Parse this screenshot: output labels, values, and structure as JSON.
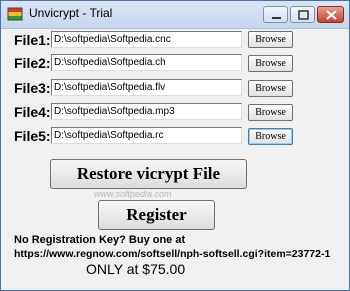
{
  "window": {
    "title": "Unvicrypt - Trial",
    "icon": "app-icon",
    "controls": [
      "minimize-icon",
      "maximize-icon",
      "close-icon"
    ]
  },
  "files": [
    {
      "label": "File1:",
      "value": "D:\\softpedia\\Softpedia.cnc",
      "browse_label": "Browse"
    },
    {
      "label": "File2:",
      "value": "D:\\softpedia\\Softpedia.ch",
      "browse_label": "Browse"
    },
    {
      "label": "File3:",
      "value": "D:\\softpedia\\Softpedia.flv",
      "browse_label": "Browse"
    },
    {
      "label": "File4:",
      "value": "D:\\softpedia\\Softpedia.mp3",
      "browse_label": "Browse"
    },
    {
      "label": "File5:",
      "value": "D:\\softpedia\\Softpedia.rc",
      "browse_label": "Browse"
    }
  ],
  "actions": {
    "restore_label": "Restore vicrypt File",
    "register_label": "Register"
  },
  "watermark": "www.softpedia.com",
  "registration": {
    "prompt": "No Registration Key?  Buy one at",
    "url": "https://www.regnow.com/softsell/nph-softsell.cgi?item=23772-1",
    "price": "ONLY at $75.00"
  }
}
